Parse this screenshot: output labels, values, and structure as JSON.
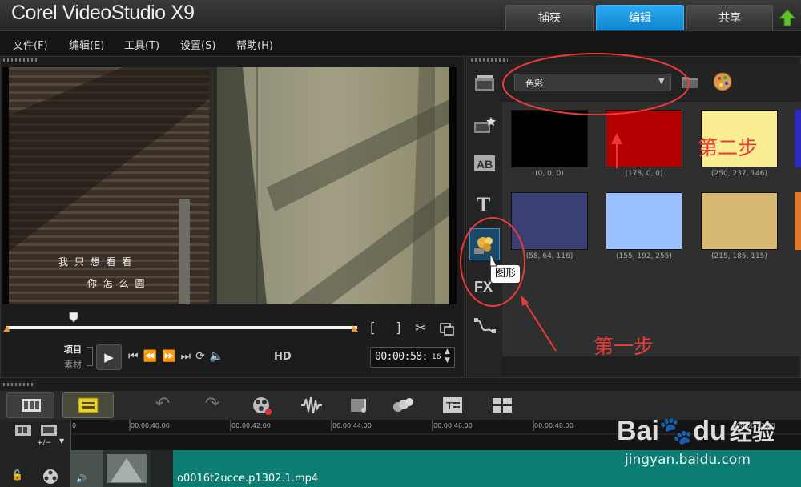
{
  "app": {
    "logo_text": "Corel VideoStudio X9"
  },
  "tabs": [
    {
      "label": "捕获",
      "active": false
    },
    {
      "label": "编辑",
      "active": true
    },
    {
      "label": "共享",
      "active": false
    }
  ],
  "menu": [
    "文件(F)",
    "编辑(E)",
    "工具(T)",
    "设置(S)",
    "帮助(H)"
  ],
  "preview": {
    "subtitle_line1": "我 只 想 看 看",
    "subtitle_line2": "你 怎 么 圆",
    "mode_project": "项目",
    "mode_clip": "素材",
    "hd_label": "HD",
    "timecode": "00:00:58:",
    "frame": "16"
  },
  "library": {
    "dropdown_value": "色彩",
    "tooltip": "图形",
    "swatches": [
      {
        "color": "#000000",
        "label": "(0, 0, 0)"
      },
      {
        "color": "#b20000",
        "label": "(178, 0, 0)"
      },
      {
        "color": "#faed92",
        "label": "(250, 237, 146)"
      },
      {
        "color": "#3a4074",
        "label": "(58, 64, 116)"
      },
      {
        "color": "#9bc0ff",
        "label": "(155, 192, 255)"
      },
      {
        "color": "#d7b973",
        "label": "(215, 185, 115)"
      }
    ]
  },
  "annotations": {
    "step1": "第一步",
    "step2": "第二步"
  },
  "timeline": {
    "ruler_ticks": [
      "00:00:40:00",
      "00:00:42:00",
      "00:00:44:00",
      "00:00:46:00",
      "00:00:48:00",
      "00:00:52:00"
    ],
    "ruler_start": "0",
    "track_add_label": "+/−",
    "clip_name": "o0016t2ucce.p1302.1.mp4"
  },
  "watermark": {
    "brand": "Bai",
    "brand2": "du",
    "product": "经验",
    "url": "jingyan.baidu.com"
  },
  "colors": {
    "accent": "#0d8fdc",
    "annotation": "#ea3a3a",
    "track": "#0b7d73"
  }
}
